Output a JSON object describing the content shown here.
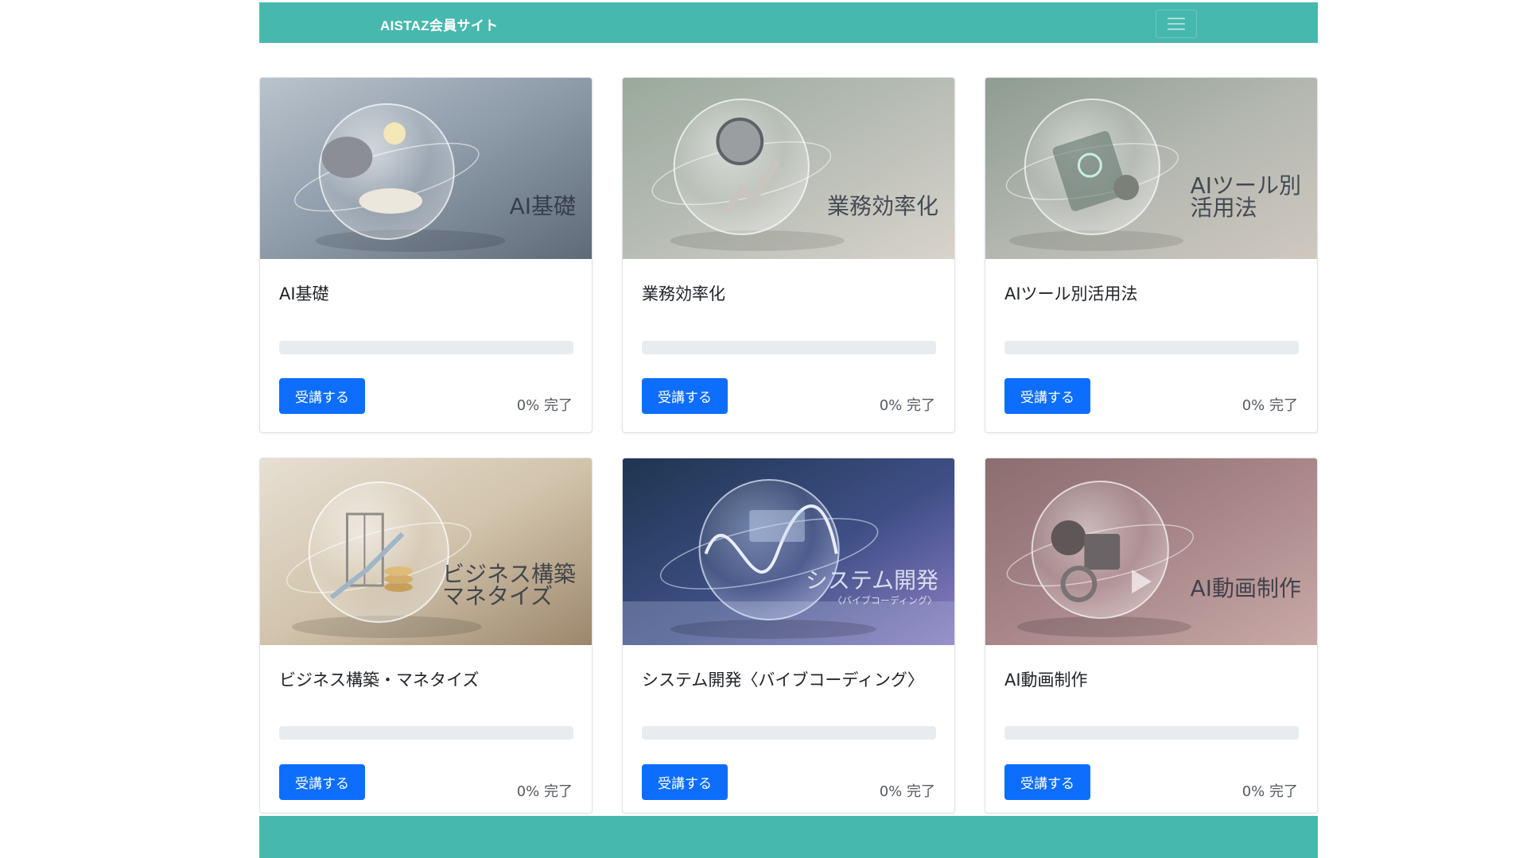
{
  "navbar": {
    "brand": "AISTAZ会員サイト",
    "menu_icon": "hamburger-menu-icon",
    "color": "#47b8ae"
  },
  "courses": [
    {
      "title": "AI基礎",
      "image_caption": [
        "AI基礎"
      ],
      "image_subcaption": "",
      "image_icon": "brain-lightbulb-book-sphere",
      "progress_percent": 0,
      "button_label": "受講する",
      "complete_text": "0% 完了"
    },
    {
      "title": "業務効率化",
      "image_caption": [
        "業務効率化"
      ],
      "image_subcaption": "",
      "image_icon": "clock-chart-sphere",
      "progress_percent": 0,
      "button_label": "受講する",
      "complete_text": "0% 完了"
    },
    {
      "title": "AIツール別活用法",
      "image_caption": [
        "AIツール別",
        "活用法"
      ],
      "image_subcaption": "",
      "image_icon": "tablet-gear-sphere",
      "progress_percent": 0,
      "button_label": "受講する",
      "complete_text": "0% 完了"
    },
    {
      "title": "ビジネス構築・マネタイズ",
      "image_caption": [
        "ビジネス構築",
        "マネタイズ"
      ],
      "image_subcaption": "",
      "image_icon": "building-coins-sphere",
      "progress_percent": 0,
      "button_label": "受講する",
      "complete_text": "0% 完了"
    },
    {
      "title": "システム開発〈バイブコーディング〉",
      "image_caption": [
        "システム開発"
      ],
      "image_subcaption": "〈バイブコーディング〉",
      "image_icon": "code-wave-sphere",
      "progress_percent": 0,
      "button_label": "受講する",
      "complete_text": "0% 完了"
    },
    {
      "title": "AI動画制作",
      "image_caption": [
        "AI動画制作"
      ],
      "image_subcaption": "",
      "image_icon": "film-reel-play-sphere",
      "progress_percent": 0,
      "button_label": "受講する",
      "complete_text": "0% 完了"
    }
  ]
}
